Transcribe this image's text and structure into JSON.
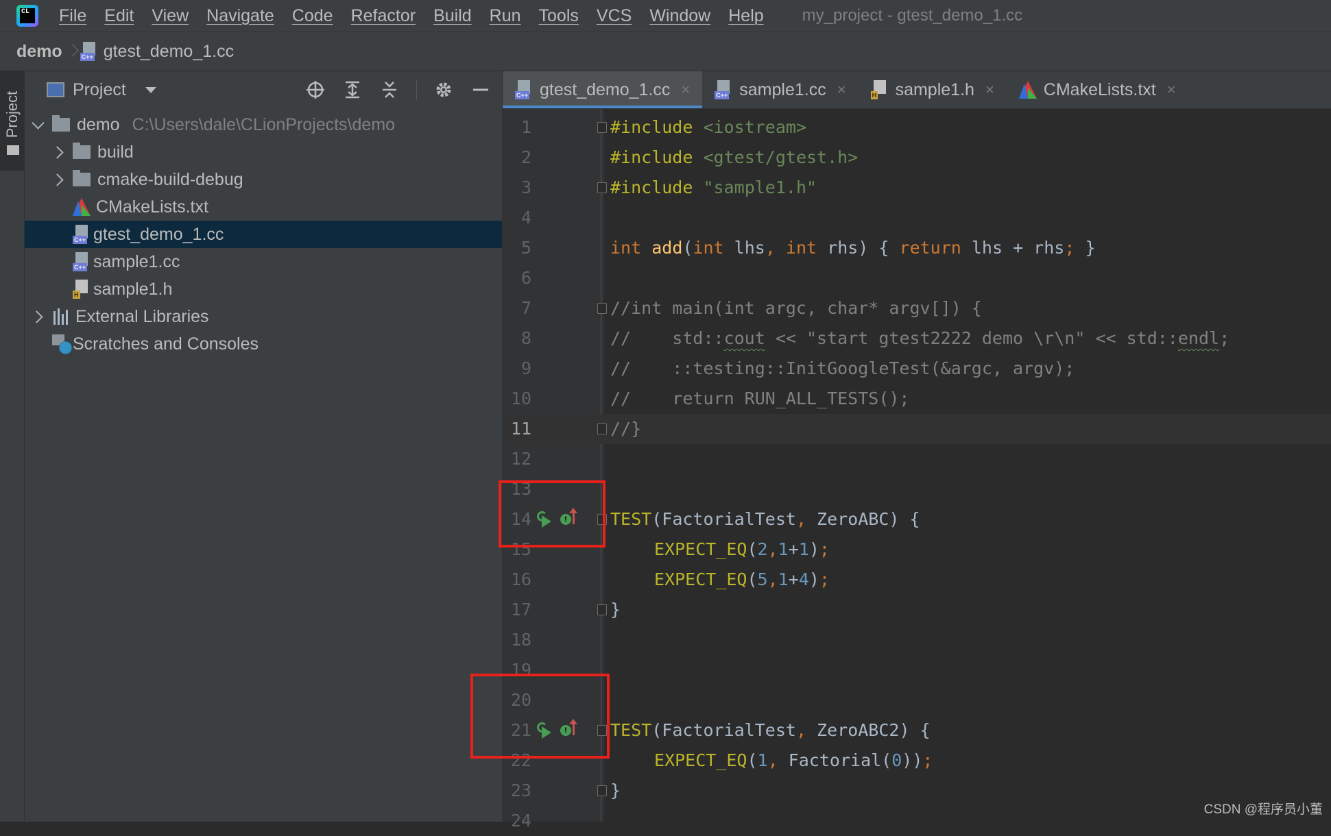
{
  "menubar": {
    "logo_text": "CL",
    "items": [
      "File",
      "Edit",
      "View",
      "Navigate",
      "Code",
      "Refactor",
      "Build",
      "Run",
      "Tools",
      "VCS",
      "Window",
      "Help"
    ],
    "window_title": "my_project - gtest_demo_1.cc"
  },
  "breadcrumb": {
    "root": "demo",
    "file": "gtest_demo_1.cc"
  },
  "toolstrip": {
    "label": "Project"
  },
  "project": {
    "title": "Project",
    "tree": [
      {
        "label": "demo",
        "path": "C:\\Users\\dale\\CLionProjects\\demo"
      },
      {
        "label": "build"
      },
      {
        "label": "cmake-build-debug"
      },
      {
        "label": "CMakeLists.txt"
      },
      {
        "label": "gtest_demo_1.cc"
      },
      {
        "label": "sample1.cc"
      },
      {
        "label": "sample1.h"
      },
      {
        "label": "External Libraries"
      },
      {
        "label": "Scratches and Consoles"
      }
    ]
  },
  "editor": {
    "tabs": [
      {
        "label": "gtest_demo_1.cc",
        "icon": "cpp-file-icon",
        "active": true
      },
      {
        "label": "sample1.cc",
        "icon": "cpp-file-icon",
        "active": false
      },
      {
        "label": "sample1.h",
        "icon": "header-file-icon",
        "active": false
      },
      {
        "label": "CMakeLists.txt",
        "icon": "cmake-icon",
        "active": false
      }
    ],
    "close_glyph": "×",
    "current_line": 11,
    "line_numbers": [
      "1",
      "2",
      "3",
      "4",
      "5",
      "6",
      "7",
      "8",
      "9",
      "10",
      "11",
      "12",
      "13",
      "14",
      "15",
      "16",
      "17",
      "18",
      "19",
      "20",
      "21",
      "22",
      "23",
      "24"
    ],
    "code": {
      "l1_directive": "#include",
      "l1_header": "<iostream>",
      "l2_directive": "#include",
      "l2_header": "<gtest/gtest.h>",
      "l3_directive": "#include",
      "l3_header": "\"sample1.h\"",
      "l5_int1": "int",
      "l5_fn": "add",
      "l5_open": "(",
      "l5_int2": "int",
      "l5_lhs": "lhs",
      "l5_comma": ",",
      "l5_int3": "int",
      "l5_rhs": "rhs) { ",
      "l5_return": "return",
      "l5_expr": " lhs + rhs",
      "l5_semi": ";",
      "l5_close": " }",
      "l7": "//int main(int argc, char* argv[]) {",
      "l8_a": "//    std::",
      "l8_cout": "cout",
      "l8_b": " << \"start gtest2222 demo \\r\\n\" << std::",
      "l8_endl": "endl",
      "l8_c": ";",
      "l9": "//    ::testing::InitGoogleTest(&argc, argv);",
      "l10": "//    return RUN_ALL_TESTS();",
      "l11": "//}",
      "l14_macro": "TEST",
      "l14_a": "(FactorialTest",
      "l14_comma": ",",
      "l14_b": " ZeroABC) {",
      "l15_macro": "EXPECT_EQ",
      "l15_open": "(",
      "l15_n1": "2",
      "l15_comma": ",",
      "l15_n2": "1",
      "l15_plus": "+",
      "l15_n3": "1",
      "l15_close": ")",
      "l15_semi": ";",
      "l16_macro": "EXPECT_EQ",
      "l16_open": "(",
      "l16_n1": "5",
      "l16_comma": ",",
      "l16_n2": "1",
      "l16_plus": "+",
      "l16_n3": "4",
      "l16_close": ")",
      "l16_semi": ";",
      "l17": "}",
      "l21_macro": "TEST",
      "l21_a": "(FactorialTest",
      "l21_comma": ",",
      "l21_b": " ZeroABC2) {",
      "l22_macro": "EXPECT_EQ",
      "l22_open": "(",
      "l22_n1": "1",
      "l22_comma": ",",
      "l22_fn": " Factorial(",
      "l22_n2": "0",
      "l22_close": "))",
      "l22_semi": ";",
      "l23": "}"
    },
    "test_status_glyph": "!"
  },
  "watermark": "CSDN @程序员小董",
  "colors": {
    "accent": "#4a88c7",
    "selection": "#0d293e",
    "highlight_box": "#e8211b",
    "run_icon": "#499c54",
    "fail_arrow": "#c75450"
  }
}
